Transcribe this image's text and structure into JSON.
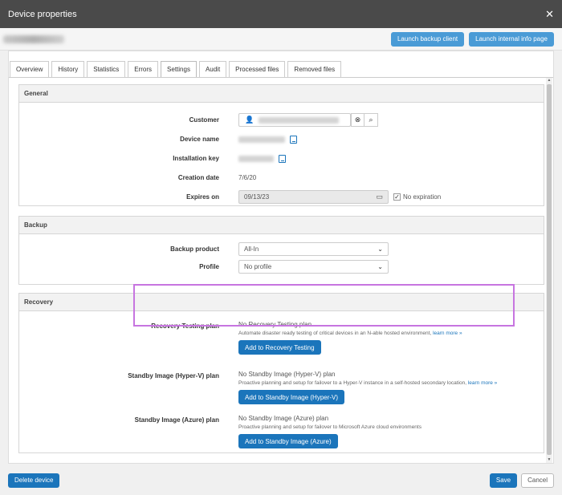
{
  "window": {
    "title": "Device properties",
    "close_glyph": "✕"
  },
  "header": {
    "launch_backup": "Launch backup client",
    "launch_info": "Launch internal info page"
  },
  "tabs": [
    "Overview",
    "History",
    "Statistics",
    "Errors",
    "Settings",
    "Audit",
    "Processed files",
    "Removed files"
  ],
  "active_tab": "Settings",
  "general": {
    "heading": "General",
    "customer_label": "Customer",
    "device_name_label": "Device name",
    "installation_key_label": "Installation key",
    "creation_date_label": "Creation date",
    "creation_date_value": "7/6/20",
    "expires_on_label": "Expires on",
    "expires_on_value": "09/13/23",
    "no_expiration_label": "No expiration"
  },
  "backup": {
    "heading": "Backup",
    "product_label": "Backup product",
    "product_value": "All-In",
    "profile_label": "Profile",
    "profile_value": "No profile"
  },
  "recovery": {
    "heading": "Recovery",
    "rt_label": "Recovery Testing plan",
    "rt_value": "No Recovery Testing plan",
    "rt_desc": "Automate disaster ready testing of critical devices in an N-able hosted environment,",
    "rt_link": "learn more »",
    "rt_button": "Add to Recovery Testing",
    "hv_label": "Standby Image (Hyper-V) plan",
    "hv_value": "No Standby Image (Hyper-V) plan",
    "hv_desc": "Proactive planning and setup for failover to a Hyper-V instance in a self-hosted secondary location,",
    "hv_link": "learn more »",
    "hv_button": "Add to Standby Image (Hyper-V)",
    "az_label": "Standby Image (Azure) plan",
    "az_value": "No Standby Image (Azure) plan",
    "az_desc": "Proactive planning and setup for failover to Microsoft Azure cloud environments",
    "az_button": "Add to Standby Image (Azure)"
  },
  "footer": {
    "delete": "Delete device",
    "save": "Save",
    "cancel": "Cancel"
  },
  "colors": {
    "accent": "#1b75bb",
    "highlight": "#c775e0",
    "titlebar": "#4a4a4a"
  }
}
